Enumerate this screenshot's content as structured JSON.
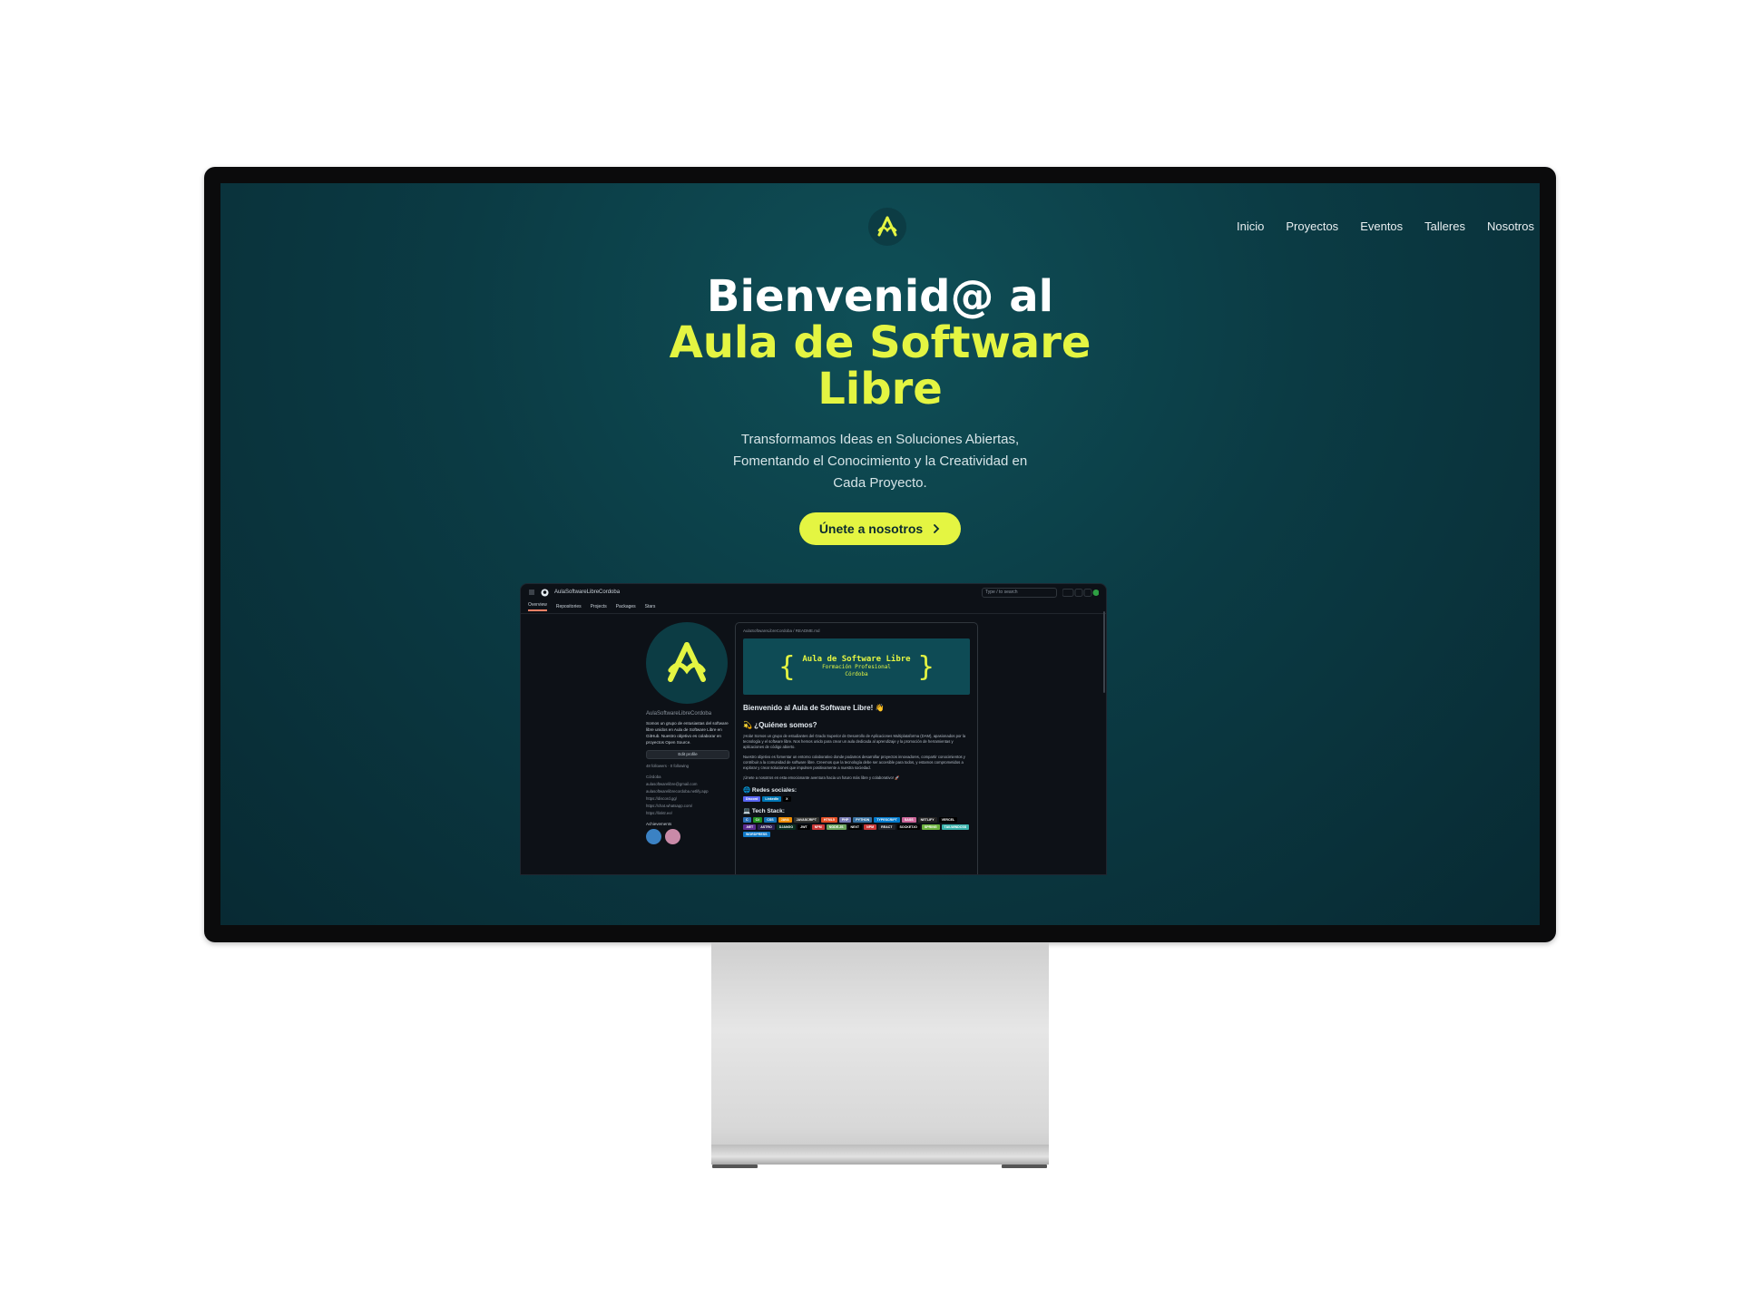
{
  "nav": {
    "items": [
      "Inicio",
      "Proyectos",
      "Eventos",
      "Talleres",
      "Nosotros"
    ]
  },
  "hero": {
    "title_line1": "Bienvenid@ al",
    "title_line2": "Aula de Software",
    "title_line3": "Libre",
    "subtitle": "Transformamos Ideas en Soluciones Abiertas, Fomentando el Conocimiento y la Creatividad en Cada Proyecto.",
    "cta_label": "Únete a nosotros",
    "accent_color": "#e4f542"
  },
  "github": {
    "repo_title": "AulaSoftwareLibreCordoba",
    "search_placeholder": "Type / to search",
    "tabs": [
      "Overview",
      "Repositories",
      "Projects",
      "Packages",
      "Stars"
    ],
    "username": "AulaSoftwareLibreCordoba",
    "bio": "Somos un grupo de entusiastas del software libre unidos en Aula de Software Libre en GitHub. Nuestro objetivo es colaborar en proyectos Open Source.",
    "edit_label": "Edit profile",
    "followers": "48 followers · 0 following",
    "meta": [
      "Córdoba",
      "aulasoftwarelibre@gmail.com",
      "aulasoftwarelibrecordoba.netlify.app",
      "https://discord.gg/",
      "https://chat.whatsapp.com/",
      "https://linktr.ee/"
    ],
    "achievements_label": "Achievements",
    "readme_path": "AulaSoftwareLibreCordoba / README.md",
    "banner_title": "Aula de Software Libre",
    "banner_sub1": "Formación Profesional",
    "banner_sub2": "Córdoba",
    "welcome": "Bienvenido al Aula de Software Libre! 👋",
    "who_heading": "💫 ¿Quiénes somos?",
    "para1": "¡Hola! Somos un grupo de estudiantes del Grado Superior de Desarrollo de Aplicaciones Multiplataforma (DAM), apasionados por la tecnología y el software libre. Nos hemos unido para crear un aula dedicada al aprendizaje y la promoción de herramientas y aplicaciones de código abierto.",
    "para2": "Nuestro objetivo es fomentar un entorno colaborativo donde podamos desarrollar proyectos innovadores, compartir conocimientos y contribuir a la comunidad de software libre. Creemos que la tecnología debe ser accesible para todos, y estamos comprometidos a explorar y crear soluciones que impulsen positivamente a nuestra sociedad.",
    "para3": "¡Únete a nosotros en esta emocionante aventura hacia un futuro más libre y colaborativo! 🚀",
    "social_heading": "🌐 Redes sociales:",
    "social": [
      "Discord",
      "LinkedIn",
      "X"
    ],
    "stack_heading": "💻 Tech Stack:",
    "stack": [
      {
        "label": "C",
        "color": "#2c6fb5"
      },
      {
        "label": "C#",
        "color": "#239120"
      },
      {
        "label": "CSS",
        "color": "#1572b6"
      },
      {
        "label": "JAVA",
        "color": "#ed8b00"
      },
      {
        "label": "JAVASCRIPT",
        "color": "#323330"
      },
      {
        "label": "HTML5",
        "color": "#e34f26"
      },
      {
        "label": "PHP",
        "color": "#777bb4"
      },
      {
        "label": "PYTHON",
        "color": "#3670a0"
      },
      {
        "label": "TYPESCRIPT",
        "color": "#007acc"
      },
      {
        "label": "SASS",
        "color": "#c69"
      },
      {
        "label": "NETLIFY",
        "color": "#222222"
      },
      {
        "label": "VERCEL",
        "color": "#000000"
      },
      {
        "label": ".NET",
        "color": "#5c2d91"
      },
      {
        "label": "ASTRO",
        "color": "#2c2052"
      },
      {
        "label": "DJANGO",
        "color": "#092e20"
      },
      {
        "label": "JWT",
        "color": "#000000"
      },
      {
        "label": "NPM",
        "color": "#cb3837"
      },
      {
        "label": "NODE.JS",
        "color": "#6da55f"
      },
      {
        "label": "NEXT",
        "color": "#000000"
      },
      {
        "label": "NPM",
        "color": "#cb3837"
      },
      {
        "label": "REACT",
        "color": "#20232a"
      },
      {
        "label": "SOCKET.IO",
        "color": "#010101"
      },
      {
        "label": "SPRING",
        "color": "#6db33f"
      },
      {
        "label": "TAILWINDCSS",
        "color": "#38b2ac"
      },
      {
        "label": "WORDPRESS",
        "color": "#117ac9"
      }
    ]
  }
}
